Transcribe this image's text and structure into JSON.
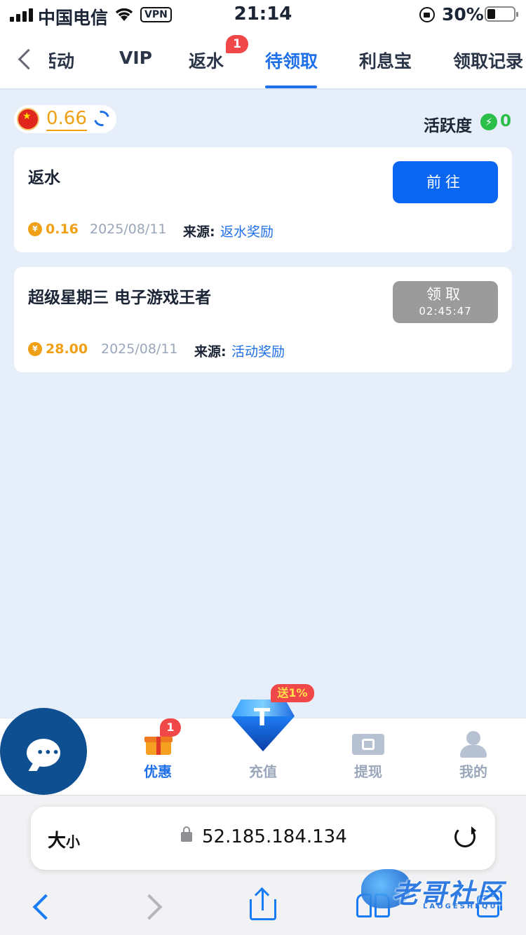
{
  "status_bar": {
    "carrier": "中国电信",
    "vpn": "VPN",
    "time": "21:14",
    "battery": "30%"
  },
  "nav": {
    "tabs": [
      {
        "label": "活动",
        "display": "活动"
      },
      {
        "label": "VIP"
      },
      {
        "label": "返水",
        "badge": "1"
      },
      {
        "label": "待领取",
        "active": true
      },
      {
        "label": "利息宝"
      },
      {
        "label": "领取记录"
      }
    ]
  },
  "balance": {
    "value": "0.66",
    "activity_label": "活跃度",
    "activity_value": "0"
  },
  "cards": [
    {
      "title": "返水",
      "amount": "0.16",
      "date": "2025/08/11",
      "source_label": "来源:",
      "source_value": "返水奖励",
      "button_label": "前往"
    },
    {
      "title": "超级星期三 电子游戏王者",
      "amount": "28.00",
      "date": "2025/08/11",
      "source_label": "来源:",
      "source_value": "活动奖励",
      "button_label": "领取",
      "button_countdown": "02:45:47"
    }
  ],
  "tabbar": {
    "items": [
      {
        "label": "优惠",
        "badge": "1",
        "active": true
      },
      {
        "label": "充值",
        "promo": "送1%"
      },
      {
        "label": "提现"
      },
      {
        "label": "我的"
      }
    ]
  },
  "browser": {
    "text_size": "大",
    "text_size_small": "小",
    "url": "52.185.184.134"
  },
  "watermark": {
    "text": "老哥社区",
    "sub": "LAOGESHEQU"
  },
  "colors": {
    "accent": "#1f6fe8",
    "amount": "#f0a015",
    "active_green": "#2bbf4a",
    "badge": "#f04848"
  }
}
